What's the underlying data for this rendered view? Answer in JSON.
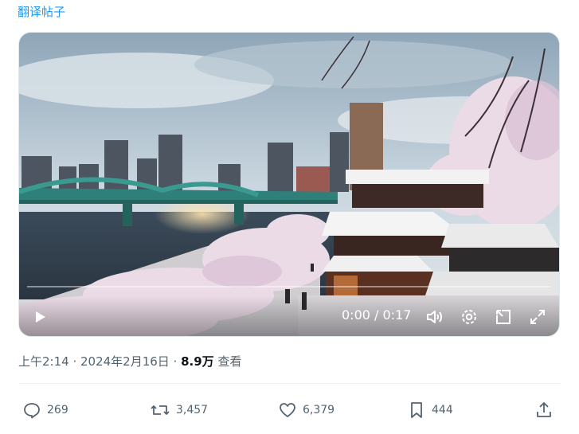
{
  "post": {
    "translate_label": "翻译帖子",
    "timestamp": "上午2:14 · 2024年2月16日 · ",
    "views": "8.9万",
    "views_label": " 查看"
  },
  "video": {
    "time": "0:00 / 0:17",
    "progress": 0,
    "icons": [
      "play-icon",
      "volume-icon",
      "settings-icon",
      "pip-icon",
      "fullscreen-icon"
    ]
  },
  "actions": {
    "replies": "269",
    "reposts": "3,457",
    "likes": "6,379",
    "bookmarks": "444",
    "icons": [
      "reply-icon",
      "repost-icon",
      "like-icon",
      "bookmark-icon",
      "share-icon"
    ]
  },
  "colors": {
    "link": "#1d9bf0",
    "muted": "#536471",
    "text": "#0f1419"
  }
}
